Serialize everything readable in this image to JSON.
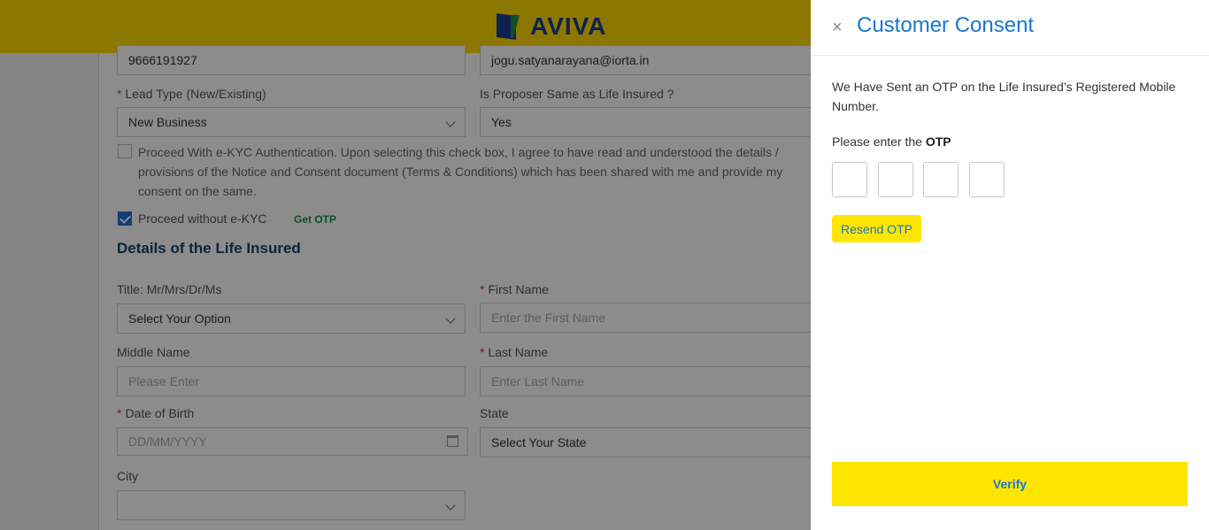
{
  "header": {
    "logo_text": "AVIVA"
  },
  "form": {
    "mobile_value": "9666191927",
    "email_value": "jogu.satyanarayana@iorta.in",
    "lead_type_label": "Lead Type (New/Existing)",
    "lead_type_value": "New Business",
    "proposer_same_label": "Is Proposer Same as Life Insured ?",
    "proposer_same_value": "Yes",
    "ekyc_consent_text": "Proceed With e-KYC Authentication. Upon selecting this check box, I agree to have read and understood the details / provisions of the Notice and Consent document (Terms & Conditions) which has been shared with me and provide my consent on the same.",
    "without_ekyc_label": "Proceed without e-KYC",
    "get_otp_label": "Get OTP",
    "section_title": "Details of the Life Insured",
    "title_label": "Title: Mr/Mrs/Dr/Ms",
    "title_value": "Select Your Option",
    "first_name_label": "First Name",
    "first_name_placeholder": "Enter the First Name",
    "middle_name_label": "Middle Name",
    "middle_name_placeholder": "Please Enter",
    "last_name_label": "Last Name",
    "last_name_placeholder": "Enter Last Name",
    "dob_label": "Date of Birth",
    "dob_placeholder": "DD/MM/YYYY",
    "state_label": "State",
    "state_value": "Select Your State",
    "city_label": "City",
    "city_value": ""
  },
  "panel": {
    "close_glyph": "×",
    "title": "Customer Consent",
    "message": "We Have Sent an OTP on the Life Insured’s Registered Mobile Number.",
    "otp_prompt_prefix": "Please enter the ",
    "otp_prompt_bold": "OTP",
    "resend_label": "Resend OTP",
    "verify_label": "Verify"
  },
  "colors": {
    "brand_yellow": "#ffe600",
    "link_blue": "#1976d2",
    "required_red": "#d32f2f",
    "get_otp_green": "#1e8f4e"
  }
}
